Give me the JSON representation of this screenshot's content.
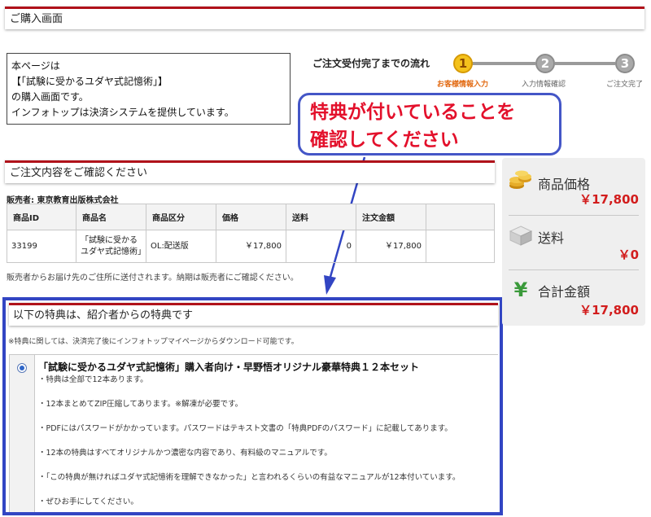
{
  "page": {
    "header_title": "ご購入画面"
  },
  "intro": {
    "line1": "本ページは",
    "line2": "【「試験に受かるユダヤ式記憶術」】",
    "line3": "の購入画面です。",
    "line4": "インフォトップは決済システムを提供しています。"
  },
  "flow": {
    "title": "ご注文受付完了までの流れ",
    "steps": [
      {
        "num": "1",
        "label": "お客様情報入力"
      },
      {
        "num": "2",
        "label": "入力情報確認"
      },
      {
        "num": "3",
        "label": "ご注文完了"
      }
    ]
  },
  "callout": {
    "line1": "特典が付いていることを",
    "line2": "確認してください"
  },
  "order": {
    "header": "ご注文内容をご確認ください",
    "seller": "販売者: 東京教育出版株式会社",
    "columns": [
      "商品ID",
      "商品名",
      "商品区分",
      "価格",
      "送料",
      "注文金額",
      ""
    ],
    "row": {
      "id": "33199",
      "name": "「試験に受かるユダヤ式記憶術」",
      "type": "OL:配送版",
      "price": "￥17,800",
      "shipping": "0",
      "total": "￥17,800"
    },
    "delivery_note": "販売者からお届け先のご住所に送付されます。納期は販売者にご確認ください。"
  },
  "bonus": {
    "header": "以下の特典は、紹介者からの特典です",
    "note": "※特典に関しては、決済完了後にインフォトップマイページからダウンロード可能です。",
    "title": "「試験に受かるユダヤ式記憶術」購入者向け・早野悟オリジナル豪華特典１２本セット",
    "lines": [
      "・特典は全部で12本あります。",
      "・12本まとめてZIP圧縮してあります。※解凍が必要です。",
      "・PDFにはパスワードがかかっています。パスワードはテキスト文書の「特典PDFのパスワード」に記載してあります。",
      "・12本の特典はすべてオリジナルかつ濃密な内容であり、有料級のマニュアルです。",
      "・「この特典が無ければユダヤ式記憶術を理解できなかった」と言われるくらいの有益なマニュアルが12本付いています。",
      "・ぜひお手にしてください。"
    ]
  },
  "summary": {
    "product_label": "商品価格",
    "product_value": "￥17,800",
    "shipping_label": "送料",
    "shipping_value": "￥0",
    "total_label": "合計金額",
    "total_value": "￥17,800",
    "icons": [
      "coins-icon",
      "box-icon",
      "yen-icon"
    ]
  },
  "colors": {
    "accent_red": "#b0121a",
    "highlight_blue": "#3245c3",
    "price_red": "#d21d1d",
    "step_active": "#f4c21c"
  }
}
